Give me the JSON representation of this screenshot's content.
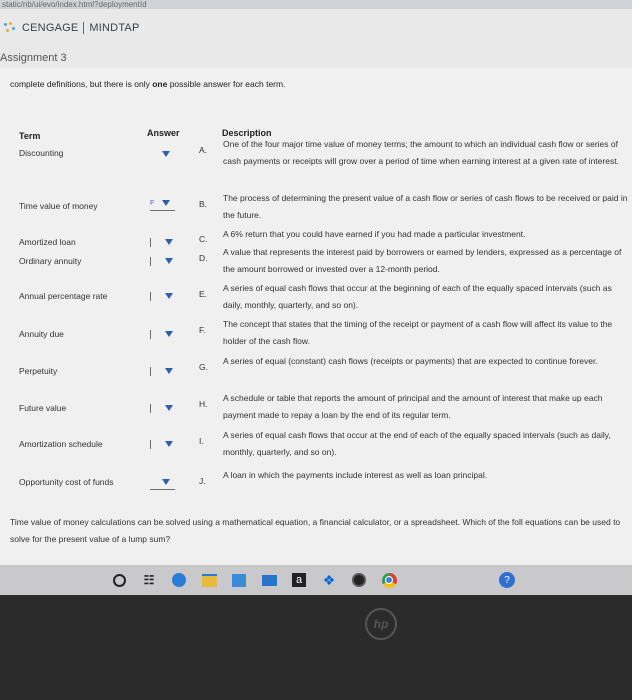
{
  "browser": {
    "url_fragment": "static/nb/ui/evo/index.html?deploymentId"
  },
  "brand": {
    "name": "CENGAGE",
    "product": "MINDTAP"
  },
  "assignment": {
    "title": "Assignment 3"
  },
  "instructions": {
    "prefix": "complete definitions, but there is only ",
    "bold": "one",
    "suffix": " possible answer for each term."
  },
  "table": {
    "headers": {
      "term": "Term",
      "answer": "Answer",
      "description": "Description"
    },
    "terms": [
      {
        "label": "Discounting",
        "selected": ""
      },
      {
        "label": "Time value of money",
        "selected": "F"
      },
      {
        "label": "Amortized loan",
        "selected": ""
      },
      {
        "label": "Ordinary annuity",
        "selected": ""
      },
      {
        "label": "Annual percentage rate",
        "selected": ""
      },
      {
        "label": "Annuity due",
        "selected": ""
      },
      {
        "label": "Perpetuity",
        "selected": ""
      },
      {
        "label": "Future value",
        "selected": ""
      },
      {
        "label": "Amortization schedule",
        "selected": ""
      },
      {
        "label": "Opportunity cost of funds",
        "selected": ""
      }
    ],
    "descriptions": [
      {
        "letter": "A.",
        "text": "One of the four major time value of money terms; the amount to which an individual cash flow or series of cash payments or receipts will grow over a period of time when earning interest at a given rate of interest."
      },
      {
        "letter": "B.",
        "text": "The process of determining the present value of a cash flow or series of cash flows to be received or paid in the future."
      },
      {
        "letter": "C.",
        "text": "A 6% return that you could have earned if you had made a particular investment."
      },
      {
        "letter": "D.",
        "text": "A value that represents the interest paid by borrowers or earned by lenders, expressed as a percentage of the amount borrowed or invested over a 12-month period."
      },
      {
        "letter": "E.",
        "text": "A series of equal cash flows that occur at the beginning of each of the equally spaced intervals (such as daily, monthly, quarterly, and so on)."
      },
      {
        "letter": "F.",
        "text": "The concept that states that the timing of the receipt or payment of a cash flow will affect its value to the holder of the cash flow."
      },
      {
        "letter": "G.",
        "text": "A series of equal (constant) cash flows (receipts or payments) that are expected to continue forever."
      },
      {
        "letter": "H.",
        "text": "A schedule or table that reports the amount of principal and the amount of interest that make up each payment made to repay a loan by the end of its regular term."
      },
      {
        "letter": "I.",
        "text": "A series of equal cash flows that occur at the end of each of the equally spaced intervals (such as daily, monthly, quarterly, and so on)."
      },
      {
        "letter": "J.",
        "text": "A loan in which the payments include interest as well as loan principal."
      }
    ]
  },
  "question": {
    "text": "Time value of money calculations can be solved using a mathematical equation, a financial calculator, or a spreadsheet. Which of the foll equations can be used to solve for the present value of a lump sum?"
  },
  "taskbar": {
    "icons": [
      "start-circle-icon",
      "task-view-icon",
      "edge-browser-icon",
      "file-explorer-icon",
      "store-icon",
      "mail-icon",
      "amazon-icon",
      "dropbox-icon",
      "media-icon",
      "chrome-icon",
      "help-icon"
    ],
    "amazon_glyph": "a"
  },
  "laptop": {
    "logo": "hp"
  },
  "colors": {
    "accent": "#2f5fa8",
    "panel": "#f0f0f1",
    "brand_dot": "#4aa3df"
  }
}
